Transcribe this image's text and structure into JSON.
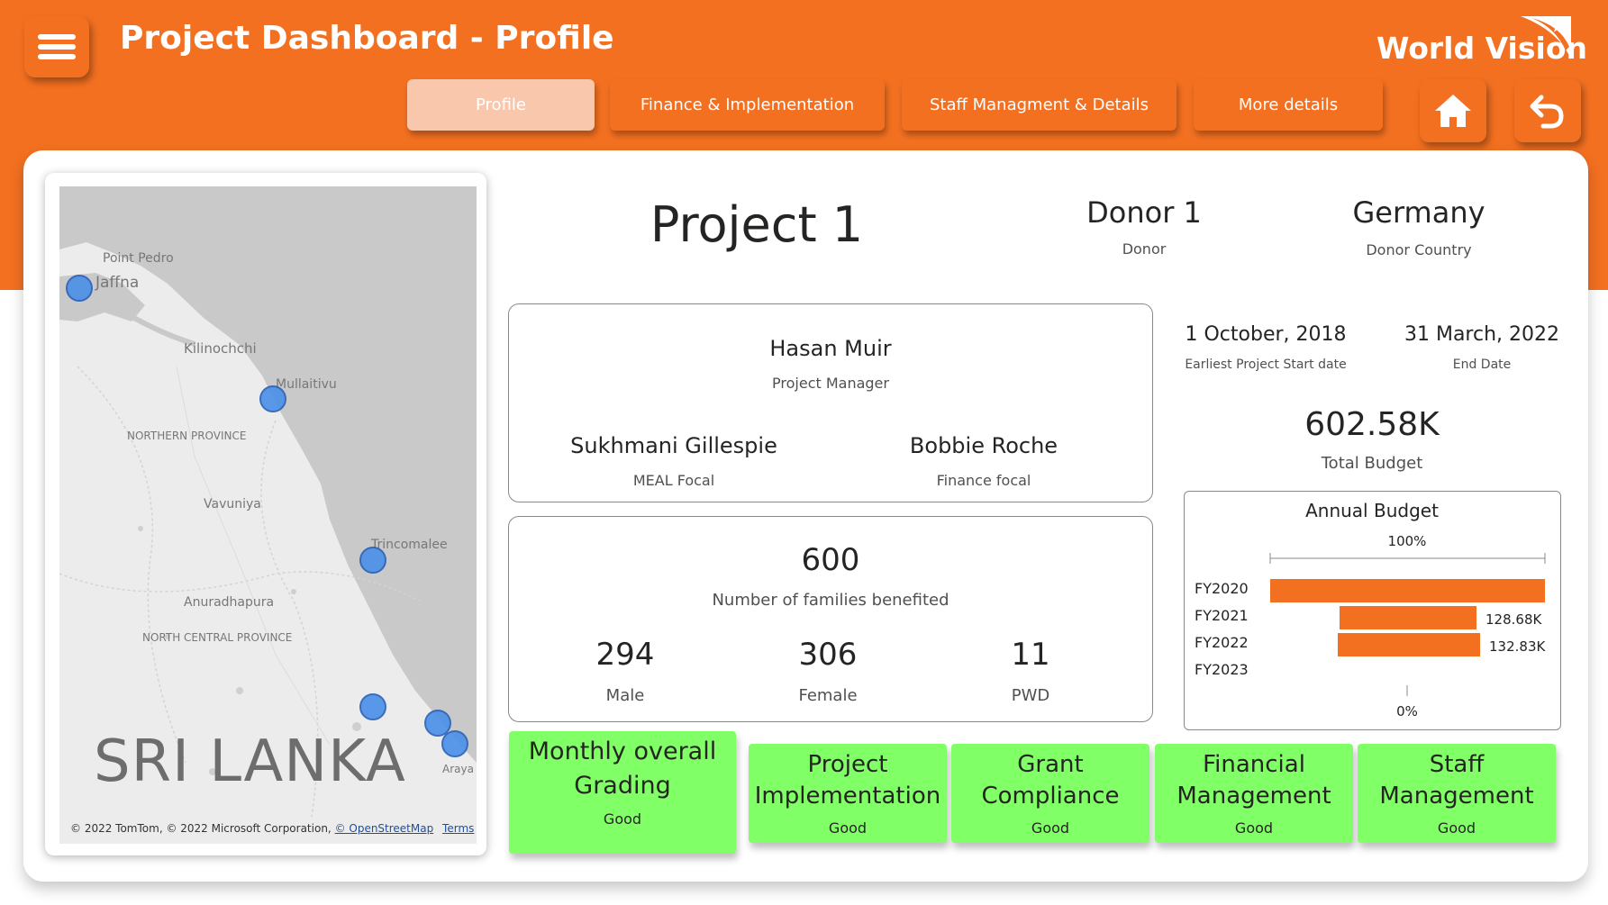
{
  "header": {
    "title": "Project Dashboard - Profile",
    "logo_text": "World Vision",
    "brand_color": "#f37021"
  },
  "nav": {
    "tabs": [
      {
        "label": "Profile",
        "active": true
      },
      {
        "label": "Finance & Implementation",
        "active": false
      },
      {
        "label": "Staff Managment & Details",
        "active": false
      },
      {
        "label": "More details",
        "active": false
      }
    ],
    "home_icon": "home-icon",
    "back_icon": "back-arrow-icon",
    "menu_icon": "hamburger-menu-icon"
  },
  "map": {
    "labels": {
      "point_pedro": "Point Pedro",
      "jaffna": "Jaffna",
      "kilinochchi": "Kilinochchi",
      "mullaitivu": "Mullaitivu",
      "northern_province": "NORTHERN PROVINCE",
      "vavuniya": "Vavuniya",
      "trincomalee": "Trincomalee",
      "anuradhapura": "Anuradhapura",
      "north_central_province": "NORTH CENTRAL PROVINCE",
      "country": "SRI LANKA",
      "araya": "Araya"
    },
    "attribution": {
      "text": "© 2022 TomTom, © 2022 Microsoft Corporation,",
      "osm": "© OpenStreetMap",
      "terms": "Terms"
    }
  },
  "project": {
    "name": "Project 1",
    "donor": "Donor 1",
    "donor_label": "Donor",
    "donor_country": "Germany",
    "donor_country_label": "Donor Country"
  },
  "staff": {
    "manager": "Hasan Muir",
    "manager_label": "Project Manager",
    "meal": "Sukhmani Gillespie",
    "meal_label": "MEAL Focal",
    "finance": "Bobbie Roche",
    "finance_label": "Finance focal"
  },
  "beneficiaries": {
    "families": "600",
    "families_label": "Number of families benefited",
    "male": "294",
    "male_label": "Male",
    "female": "306",
    "female_label": "Female",
    "pwd": "11",
    "pwd_label": "PWD"
  },
  "dates": {
    "start": "1 October, 2018",
    "start_label": "Earliest Project Start date",
    "end": "31 March, 2022",
    "end_label": "End Date"
  },
  "budget": {
    "total": "602.58K",
    "total_label": "Total Budget"
  },
  "chart_data": {
    "type": "bar",
    "title": "Annual Budget",
    "categories": [
      "FY2020",
      "FY2021",
      "FY2022",
      "FY2023"
    ],
    "values": [
      341.07,
      128.68,
      132.83,
      0
    ],
    "data_labels": [
      "",
      "128.68K",
      "132.83K",
      ""
    ],
    "axis_top_label": "100%",
    "axis_bottom_label": "0%",
    "bar_color": "#f37021"
  },
  "grading": {
    "overall": {
      "title": "Monthly overall Grading",
      "status": "Good"
    },
    "items": [
      {
        "title": "Project Implementation",
        "status": "Good"
      },
      {
        "title": "Grant Compliance",
        "status": "Good"
      },
      {
        "title": "Financial Management",
        "status": "Good"
      },
      {
        "title": "Staff Management",
        "status": "Good"
      }
    ],
    "status_color": "#80ff66"
  }
}
